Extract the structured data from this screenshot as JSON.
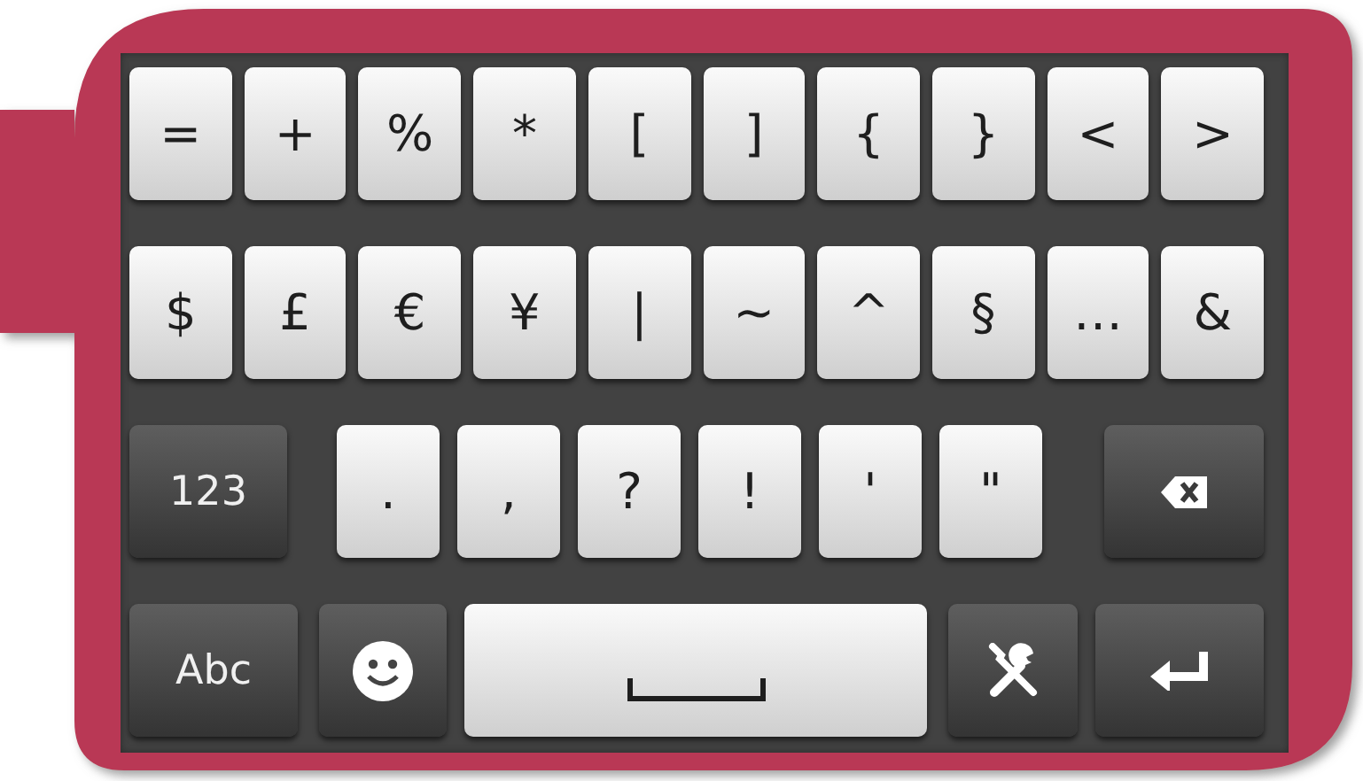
{
  "keyboard": {
    "rows": [
      {
        "keys": [
          {
            "kind": "char",
            "label": "="
          },
          {
            "kind": "char",
            "label": "+"
          },
          {
            "kind": "char",
            "label": "%"
          },
          {
            "kind": "char",
            "label": "*"
          },
          {
            "kind": "char",
            "label": "["
          },
          {
            "kind": "char",
            "label": "]"
          },
          {
            "kind": "char",
            "label": "{"
          },
          {
            "kind": "char",
            "label": "}"
          },
          {
            "kind": "char",
            "label": "<"
          },
          {
            "kind": "char",
            "label": ">"
          }
        ]
      },
      {
        "keys": [
          {
            "kind": "char",
            "label": "$"
          },
          {
            "kind": "char",
            "label": "£"
          },
          {
            "kind": "char",
            "label": "€"
          },
          {
            "kind": "char",
            "label": "¥"
          },
          {
            "kind": "char",
            "label": "|"
          },
          {
            "kind": "char",
            "label": "~"
          },
          {
            "kind": "char",
            "label": "^"
          },
          {
            "kind": "char",
            "label": "§"
          },
          {
            "kind": "char",
            "label": "…"
          },
          {
            "kind": "char",
            "label": "&"
          }
        ]
      },
      {
        "keys": [
          {
            "kind": "mode",
            "label": "123"
          },
          {
            "kind": "char",
            "label": "."
          },
          {
            "kind": "char",
            "label": ","
          },
          {
            "kind": "char",
            "label": "?"
          },
          {
            "kind": "char",
            "label": "!"
          },
          {
            "kind": "char",
            "label": "'"
          },
          {
            "kind": "char",
            "label": "\""
          },
          {
            "kind": "backspace"
          }
        ]
      },
      {
        "keys": [
          {
            "kind": "mode",
            "label": "Abc"
          },
          {
            "kind": "emoji"
          },
          {
            "kind": "space"
          },
          {
            "kind": "settings"
          },
          {
            "kind": "enter"
          }
        ]
      }
    ]
  }
}
